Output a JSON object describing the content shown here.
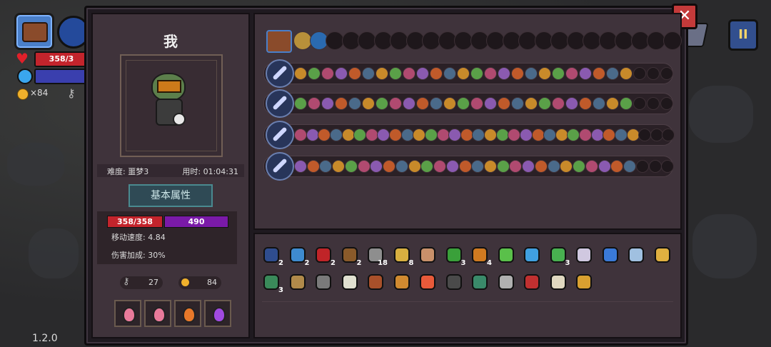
{
  "hud": {
    "hp_text": "358/3",
    "coins_text": "×84",
    "version": "1.2.0",
    "pause_label": "II",
    "close_label": "✕"
  },
  "character": {
    "name": "我",
    "difficulty": "难度: 噩梦3",
    "time": "用时: 01:04:31",
    "attr_button": "基本属性",
    "hp": "358/358",
    "mp": "490",
    "move_speed": "移动速度: 4.84",
    "damage_bonus": "伤害加成: 30%",
    "keys": "27",
    "gold": "84",
    "potions": [
      "pink-potion",
      "pink-potion",
      "orange-potion",
      "purple-potion"
    ]
  },
  "weapon_rows": [
    {
      "icon": "chest-icon",
      "slots": 24
    },
    {
      "icon": "frost-wand-icon",
      "slots": 28
    },
    {
      "icon": "crystal-wand-icon",
      "slots": 28
    },
    {
      "icon": "golden-spear-icon",
      "slots": 32
    },
    {
      "icon": "blue-staff-icon",
      "slots": 30
    }
  ],
  "items": [
    {
      "icon": "blue-hood-icon",
      "count": "2",
      "color": "#2f4d8f"
    },
    {
      "icon": "crossbow-icon",
      "count": "2",
      "color": "#3e8bd0"
    },
    {
      "icon": "red-eye-icon",
      "count": "2",
      "color": "#c02428"
    },
    {
      "icon": "barrel-icon",
      "count": "2",
      "color": "#8a5a2a"
    },
    {
      "icon": "arrow-bundle-icon",
      "count": "18",
      "color": "#8e8e8e"
    },
    {
      "icon": "plus-arrow-icon",
      "count": "8",
      "color": "#d8b040"
    },
    {
      "icon": "egg-icon",
      "count": "",
      "color": "#c8906a"
    },
    {
      "icon": "green-leaf-icon",
      "count": "3",
      "color": "#3aa03a"
    },
    {
      "icon": "orange-bow-icon",
      "count": "4",
      "color": "#d07a20"
    },
    {
      "icon": "green-sprout-icon",
      "count": "",
      "color": "#5ac04a"
    },
    {
      "icon": "blue-arrow-icon",
      "count": "",
      "color": "#40a0e0"
    },
    {
      "icon": "green-arrow-icon",
      "count": "3",
      "color": "#48b050"
    },
    {
      "icon": "white-quill-icon",
      "count": "",
      "color": "#d0c8e0"
    },
    {
      "icon": "blue-gem-icon",
      "count": "",
      "color": "#3a7ad8"
    },
    {
      "icon": "silver-key-icon",
      "count": "",
      "color": "#a0c0e0"
    },
    {
      "icon": "magnifier-icon",
      "count": "",
      "color": "#e0b040"
    },
    {
      "icon": "green-belt-icon",
      "count": "3",
      "color": "#3a8a5a"
    },
    {
      "icon": "bronze-amulet-icon",
      "count": "",
      "color": "#b08a4a"
    },
    {
      "icon": "hook-icon",
      "count": "",
      "color": "#7a7a7a"
    },
    {
      "icon": "fangs-icon",
      "count": "",
      "color": "#e0e0d0"
    },
    {
      "icon": "crate-icon",
      "count": "",
      "color": "#a8502a"
    },
    {
      "icon": "scroll-icon",
      "count": "",
      "color": "#d08a30"
    },
    {
      "icon": "heart-icon",
      "count": "",
      "color": "#e85a3a"
    },
    {
      "icon": "dark-hood-icon",
      "count": "",
      "color": "#4a4a4a"
    },
    {
      "icon": "green-box-icon",
      "count": "",
      "color": "#3a8a6a"
    },
    {
      "icon": "bone-icon",
      "count": "",
      "color": "#b0b0b0"
    },
    {
      "icon": "red-chain-icon",
      "count": "",
      "color": "#c03030"
    },
    {
      "icon": "wing-icon",
      "count": "",
      "color": "#e0d8c0"
    },
    {
      "icon": "golden-goblet-icon",
      "count": "",
      "color": "#d8a030"
    }
  ]
}
